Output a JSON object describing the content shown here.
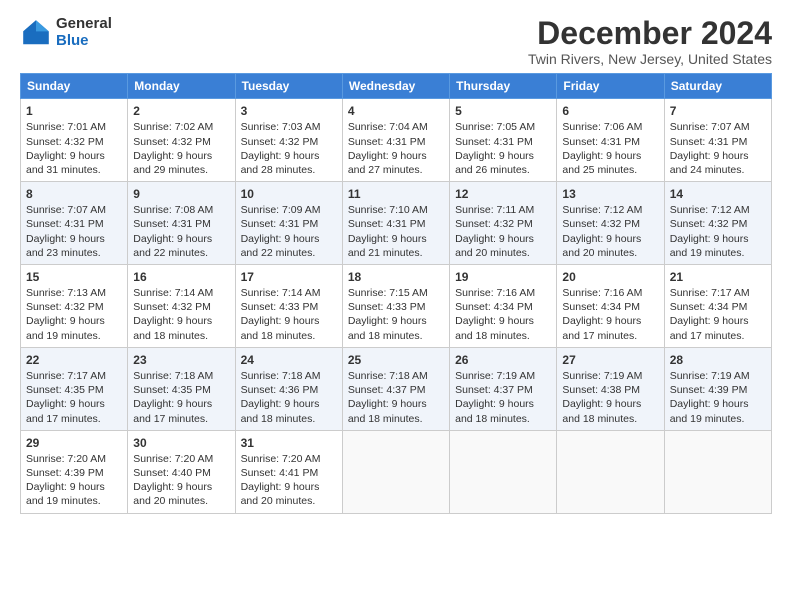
{
  "logo": {
    "general": "General",
    "blue": "Blue"
  },
  "title": "December 2024",
  "location": "Twin Rivers, New Jersey, United States",
  "days_of_week": [
    "Sunday",
    "Monday",
    "Tuesday",
    "Wednesday",
    "Thursday",
    "Friday",
    "Saturday"
  ],
  "weeks": [
    [
      {
        "day": "1",
        "sunrise": "Sunrise: 7:01 AM",
        "sunset": "Sunset: 4:32 PM",
        "daylight": "Daylight: 9 hours and 31 minutes."
      },
      {
        "day": "2",
        "sunrise": "Sunrise: 7:02 AM",
        "sunset": "Sunset: 4:32 PM",
        "daylight": "Daylight: 9 hours and 29 minutes."
      },
      {
        "day": "3",
        "sunrise": "Sunrise: 7:03 AM",
        "sunset": "Sunset: 4:32 PM",
        "daylight": "Daylight: 9 hours and 28 minutes."
      },
      {
        "day": "4",
        "sunrise": "Sunrise: 7:04 AM",
        "sunset": "Sunset: 4:31 PM",
        "daylight": "Daylight: 9 hours and 27 minutes."
      },
      {
        "day": "5",
        "sunrise": "Sunrise: 7:05 AM",
        "sunset": "Sunset: 4:31 PM",
        "daylight": "Daylight: 9 hours and 26 minutes."
      },
      {
        "day": "6",
        "sunrise": "Sunrise: 7:06 AM",
        "sunset": "Sunset: 4:31 PM",
        "daylight": "Daylight: 9 hours and 25 minutes."
      },
      {
        "day": "7",
        "sunrise": "Sunrise: 7:07 AM",
        "sunset": "Sunset: 4:31 PM",
        "daylight": "Daylight: 9 hours and 24 minutes."
      }
    ],
    [
      {
        "day": "8",
        "sunrise": "Sunrise: 7:07 AM",
        "sunset": "Sunset: 4:31 PM",
        "daylight": "Daylight: 9 hours and 23 minutes."
      },
      {
        "day": "9",
        "sunrise": "Sunrise: 7:08 AM",
        "sunset": "Sunset: 4:31 PM",
        "daylight": "Daylight: 9 hours and 22 minutes."
      },
      {
        "day": "10",
        "sunrise": "Sunrise: 7:09 AM",
        "sunset": "Sunset: 4:31 PM",
        "daylight": "Daylight: 9 hours and 22 minutes."
      },
      {
        "day": "11",
        "sunrise": "Sunrise: 7:10 AM",
        "sunset": "Sunset: 4:31 PM",
        "daylight": "Daylight: 9 hours and 21 minutes."
      },
      {
        "day": "12",
        "sunrise": "Sunrise: 7:11 AM",
        "sunset": "Sunset: 4:32 PM",
        "daylight": "Daylight: 9 hours and 20 minutes."
      },
      {
        "day": "13",
        "sunrise": "Sunrise: 7:12 AM",
        "sunset": "Sunset: 4:32 PM",
        "daylight": "Daylight: 9 hours and 20 minutes."
      },
      {
        "day": "14",
        "sunrise": "Sunrise: 7:12 AM",
        "sunset": "Sunset: 4:32 PM",
        "daylight": "Daylight: 9 hours and 19 minutes."
      }
    ],
    [
      {
        "day": "15",
        "sunrise": "Sunrise: 7:13 AM",
        "sunset": "Sunset: 4:32 PM",
        "daylight": "Daylight: 9 hours and 19 minutes."
      },
      {
        "day": "16",
        "sunrise": "Sunrise: 7:14 AM",
        "sunset": "Sunset: 4:32 PM",
        "daylight": "Daylight: 9 hours and 18 minutes."
      },
      {
        "day": "17",
        "sunrise": "Sunrise: 7:14 AM",
        "sunset": "Sunset: 4:33 PM",
        "daylight": "Daylight: 9 hours and 18 minutes."
      },
      {
        "day": "18",
        "sunrise": "Sunrise: 7:15 AM",
        "sunset": "Sunset: 4:33 PM",
        "daylight": "Daylight: 9 hours and 18 minutes."
      },
      {
        "day": "19",
        "sunrise": "Sunrise: 7:16 AM",
        "sunset": "Sunset: 4:34 PM",
        "daylight": "Daylight: 9 hours and 18 minutes."
      },
      {
        "day": "20",
        "sunrise": "Sunrise: 7:16 AM",
        "sunset": "Sunset: 4:34 PM",
        "daylight": "Daylight: 9 hours and 17 minutes."
      },
      {
        "day": "21",
        "sunrise": "Sunrise: 7:17 AM",
        "sunset": "Sunset: 4:34 PM",
        "daylight": "Daylight: 9 hours and 17 minutes."
      }
    ],
    [
      {
        "day": "22",
        "sunrise": "Sunrise: 7:17 AM",
        "sunset": "Sunset: 4:35 PM",
        "daylight": "Daylight: 9 hours and 17 minutes."
      },
      {
        "day": "23",
        "sunrise": "Sunrise: 7:18 AM",
        "sunset": "Sunset: 4:35 PM",
        "daylight": "Daylight: 9 hours and 17 minutes."
      },
      {
        "day": "24",
        "sunrise": "Sunrise: 7:18 AM",
        "sunset": "Sunset: 4:36 PM",
        "daylight": "Daylight: 9 hours and 18 minutes."
      },
      {
        "day": "25",
        "sunrise": "Sunrise: 7:18 AM",
        "sunset": "Sunset: 4:37 PM",
        "daylight": "Daylight: 9 hours and 18 minutes."
      },
      {
        "day": "26",
        "sunrise": "Sunrise: 7:19 AM",
        "sunset": "Sunset: 4:37 PM",
        "daylight": "Daylight: 9 hours and 18 minutes."
      },
      {
        "day": "27",
        "sunrise": "Sunrise: 7:19 AM",
        "sunset": "Sunset: 4:38 PM",
        "daylight": "Daylight: 9 hours and 18 minutes."
      },
      {
        "day": "28",
        "sunrise": "Sunrise: 7:19 AM",
        "sunset": "Sunset: 4:39 PM",
        "daylight": "Daylight: 9 hours and 19 minutes."
      }
    ],
    [
      {
        "day": "29",
        "sunrise": "Sunrise: 7:20 AM",
        "sunset": "Sunset: 4:39 PM",
        "daylight": "Daylight: 9 hours and 19 minutes."
      },
      {
        "day": "30",
        "sunrise": "Sunrise: 7:20 AM",
        "sunset": "Sunset: 4:40 PM",
        "daylight": "Daylight: 9 hours and 20 minutes."
      },
      {
        "day": "31",
        "sunrise": "Sunrise: 7:20 AM",
        "sunset": "Sunset: 4:41 PM",
        "daylight": "Daylight: 9 hours and 20 minutes."
      },
      null,
      null,
      null,
      null
    ]
  ]
}
